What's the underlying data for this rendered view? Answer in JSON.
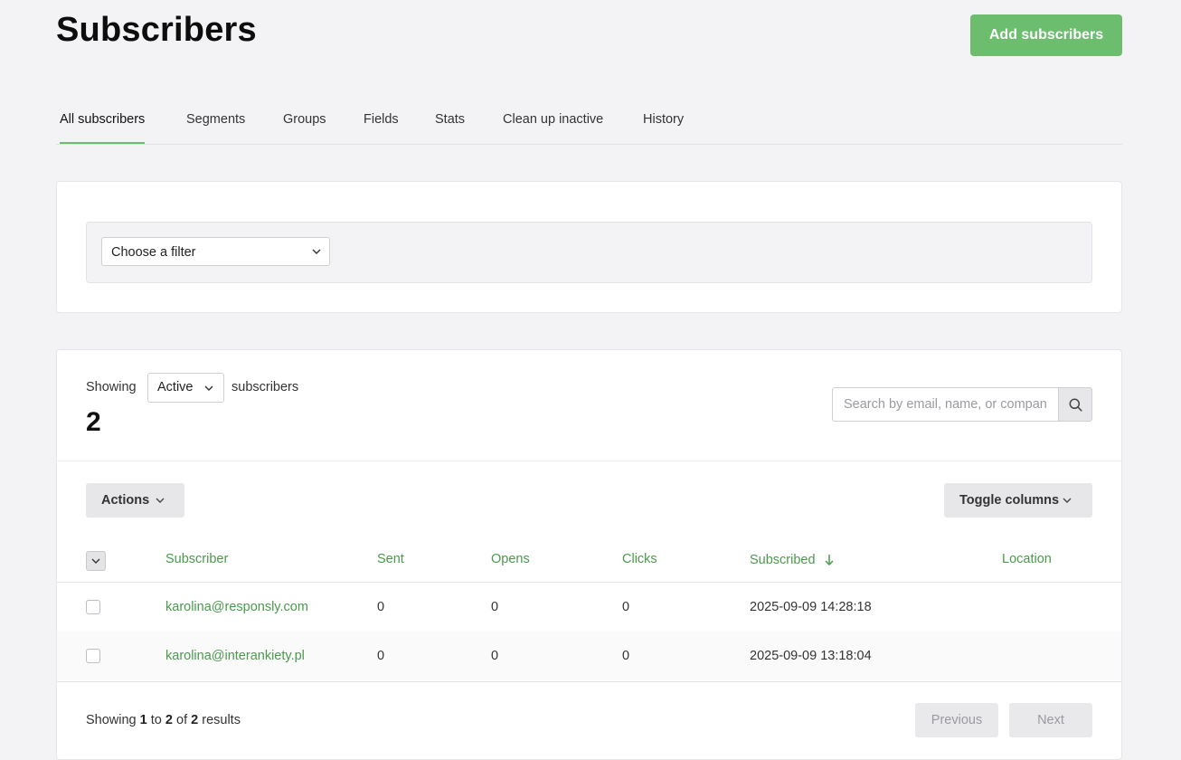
{
  "header": {
    "title": "Subscribers",
    "add_button": "Add subscribers"
  },
  "tabs": [
    {
      "label": "All subscribers",
      "active": true
    },
    {
      "label": "Segments"
    },
    {
      "label": "Groups"
    },
    {
      "label": "Fields"
    },
    {
      "label": "Stats"
    },
    {
      "label": "Clean up inactive"
    },
    {
      "label": "History"
    }
  ],
  "filter": {
    "selected": "Choose a filter"
  },
  "list": {
    "showing_label": "Showing",
    "status_selected": "Active",
    "subscribers_label": "subscribers",
    "count": "2",
    "search_placeholder": "Search by email, name, or company",
    "actions_label": "Actions",
    "toggle_columns_label": "Toggle columns",
    "columns": {
      "subscriber": "Subscriber",
      "sent": "Sent",
      "opens": "Opens",
      "clicks": "Clicks",
      "subscribed": "Subscribed",
      "location": "Location"
    },
    "rows": [
      {
        "email": "karolina@responsly.com",
        "sent": "0",
        "opens": "0",
        "clicks": "0",
        "subscribed": "2025-09-09 14:28:18",
        "location": ""
      },
      {
        "email": "karolina@interankiety.pl",
        "sent": "0",
        "opens": "0",
        "clicks": "0",
        "subscribed": "2025-09-09 13:18:04",
        "location": ""
      }
    ],
    "footer": {
      "prefix": "Showing",
      "from": "1",
      "to_word": "to",
      "to": "2",
      "of_word": "of",
      "total": "2",
      "suffix": "results"
    },
    "previous_label": "Previous",
    "next_label": "Next"
  },
  "colors": {
    "accent": "#6cbe6e",
    "link": "#4a9a4c",
    "background": "#f3f3f5"
  }
}
